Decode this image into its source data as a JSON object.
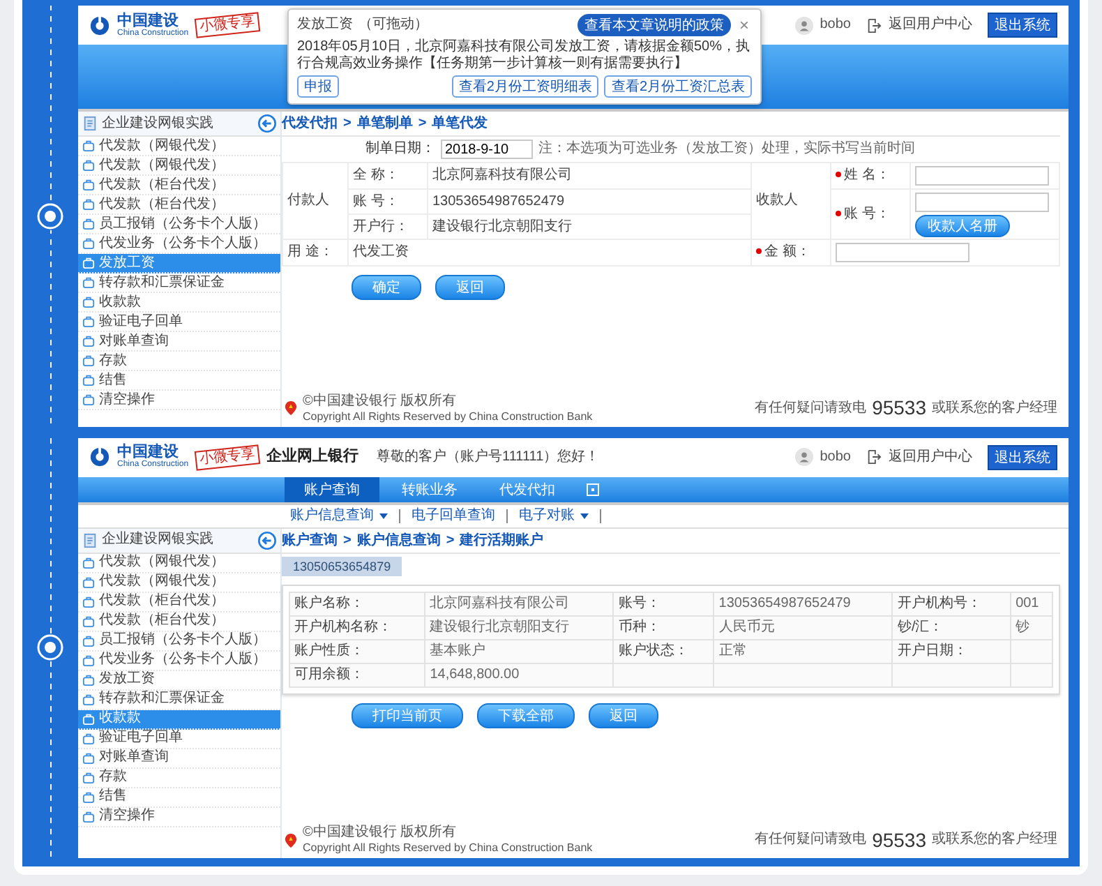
{
  "screens": [
    {
      "kind": "payroll",
      "header": {
        "logo_text": "中国建设",
        "logo_en": "China Construction",
        "badge": "小微专享",
        "user": "bobo",
        "back_link": "返回用户中心",
        "logout": "退出系统"
      },
      "popup": {
        "title": "发放工资",
        "hint": "（可拖动）",
        "policy_button": "查看本文章说明的政策",
        "close": "×",
        "text": "2018年05月10日，北京阿嘉科技有限公司发放工资，请核据金额50%，执行合规高效业务操作【任务期第一步计算核一则有据需要执行】",
        "buttons": [
          "申报",
          "查看2月份工资明细表",
          "查看2月份工资汇总表"
        ]
      },
      "sidebar": {
        "title": "企业建设网银实践",
        "items": [
          {
            "label": "代发款（网银代发）",
            "selected": false
          },
          {
            "label": "代发款（网银代发）",
            "selected": false
          },
          {
            "label": "代发款（柜台代发）",
            "selected": false
          },
          {
            "label": "代发款（柜台代发）",
            "selected": false
          },
          {
            "label": "员工报销（公务卡个人版）",
            "selected": false
          },
          {
            "label": "代发业务（公务卡个人版）",
            "selected": false
          },
          {
            "label": "发放工资",
            "selected": true
          },
          {
            "label": "转存款和汇票保证金",
            "selected": false
          },
          {
            "label": "收款款",
            "selected": false
          },
          {
            "label": "验证电子回单",
            "selected": false
          },
          {
            "label": "对账单查询",
            "selected": false
          },
          {
            "label": "存款",
            "selected": false
          },
          {
            "label": "结售",
            "selected": false
          },
          {
            "label": "清空操作",
            "selected": false
          }
        ]
      },
      "main": {
        "breadcrumb": [
          "代发代扣",
          "单笔制单",
          "单笔代发"
        ],
        "breadcrumb_separator": ">",
        "date_label": "制单日期：",
        "date_value": "2018-9-10",
        "date_note": "注：本选项为可选业务（发放工资）处理，实际书写当前时间",
        "payer": {
          "label": "付款人",
          "fields": [
            {
              "label": "全 称：",
              "value": "北京阿嘉科技有限公司"
            },
            {
              "label": "账 号：",
              "value": "13053654987652479"
            },
            {
              "label": "开户行：",
              "value": "建设银行北京朝阳支行"
            }
          ]
        },
        "payee": {
          "label": "收款人",
          "fields": [
            {
              "label": "姓 名：",
              "required": true
            },
            {
              "label": "账 号：",
              "required": true
            }
          ],
          "roster_button": "收款人名册"
        },
        "purpose": {
          "label": "用 途：",
          "value": "代发工资"
        },
        "amount": {
          "label": "金 额：",
          "required": true
        },
        "buttons": [
          "确定",
          "返回"
        ]
      },
      "footer": {
        "copyright": "©中国建设银行 版权所有",
        "rights": "Copyright All Rights Reserved by China Construction Bank",
        "hotline_label": "有任何疑问请致电",
        "hotline": "95533",
        "hotline_suffix": "或联系您的客户经理"
      }
    },
    {
      "kind": "account",
      "header": {
        "logo_text": "中国建设",
        "logo_en": "China Construction",
        "badge": "小微专享",
        "title": "企业网上银行",
        "greeting": "尊敬的客户（账户号111111）您好！",
        "user": "bobo",
        "back_link": "返回用户中心",
        "logout": "退出系统"
      },
      "tabs": [
        {
          "label": "账户查询",
          "selected": true
        },
        {
          "label": "转账业务",
          "selected": false
        },
        {
          "label": "代发代扣",
          "selected": false
        }
      ],
      "subnav": [
        {
          "label": "账户信息查询",
          "dropdown": true
        },
        {
          "label": "电子回单查询",
          "dropdown": false
        },
        {
          "label": "电子对账",
          "dropdown": true
        }
      ],
      "sidebar": {
        "title": "企业建设网银实践",
        "items": [
          {
            "label": "代发款（网银代发）",
            "selected": false
          },
          {
            "label": "代发款（网银代发）",
            "selected": false
          },
          {
            "label": "代发款（柜台代发）",
            "selected": false
          },
          {
            "label": "代发款（柜台代发）",
            "selected": false
          },
          {
            "label": "员工报销（公务卡个人版）",
            "selected": false
          },
          {
            "label": "代发业务（公务卡个人版）",
            "selected": false
          },
          {
            "label": "发放工资",
            "selected": false
          },
          {
            "label": "转存款和汇票保证金",
            "selected": false
          },
          {
            "label": "收款款",
            "selected": true
          },
          {
            "label": "验证电子回单",
            "selected": false
          },
          {
            "label": "对账单查询",
            "selected": false
          },
          {
            "label": "存款",
            "selected": false
          },
          {
            "label": "结售",
            "selected": false
          },
          {
            "label": "清空操作",
            "selected": false
          }
        ]
      },
      "main": {
        "breadcrumb": [
          "账户查询",
          "账户信息查询",
          "建行活期账户"
        ],
        "breadcrumb_separator": ">",
        "account_tab": "13050653654879",
        "rows": [
          [
            {
              "label": "账户名称：",
              "value": "北京阿嘉科技有限公司"
            },
            {
              "label": "账号：",
              "value": "13053654987652479"
            },
            {
              "label": "开户机构号：",
              "value": "001"
            }
          ],
          [
            {
              "label": "开户机构名称：",
              "value": "建设银行北京朝阳支行"
            },
            {
              "label": "币种：",
              "value": "人民币元"
            },
            {
              "label": "钞/汇：",
              "value": "钞"
            }
          ],
          [
            {
              "label": "账户性质：",
              "value": "基本账户"
            },
            {
              "label": "账户状态：",
              "value": "正常"
            },
            {
              "label": "开户日期："
            }
          ],
          [
            {
              "label": "可用余额：",
              "value": "14,648,800.00"
            }
          ]
        ],
        "buttons": [
          "打印当前页",
          "下载全部",
          "返回"
        ]
      },
      "footer": {
        "copyright": "©中国建设银行 版权所有",
        "rights": "Copyright All Rights Reserved by China Construction Bank",
        "hotline_label": "有任何疑问请致电",
        "hotline": "95533",
        "hotline_suffix": "或联系您的客户经理"
      }
    }
  ]
}
